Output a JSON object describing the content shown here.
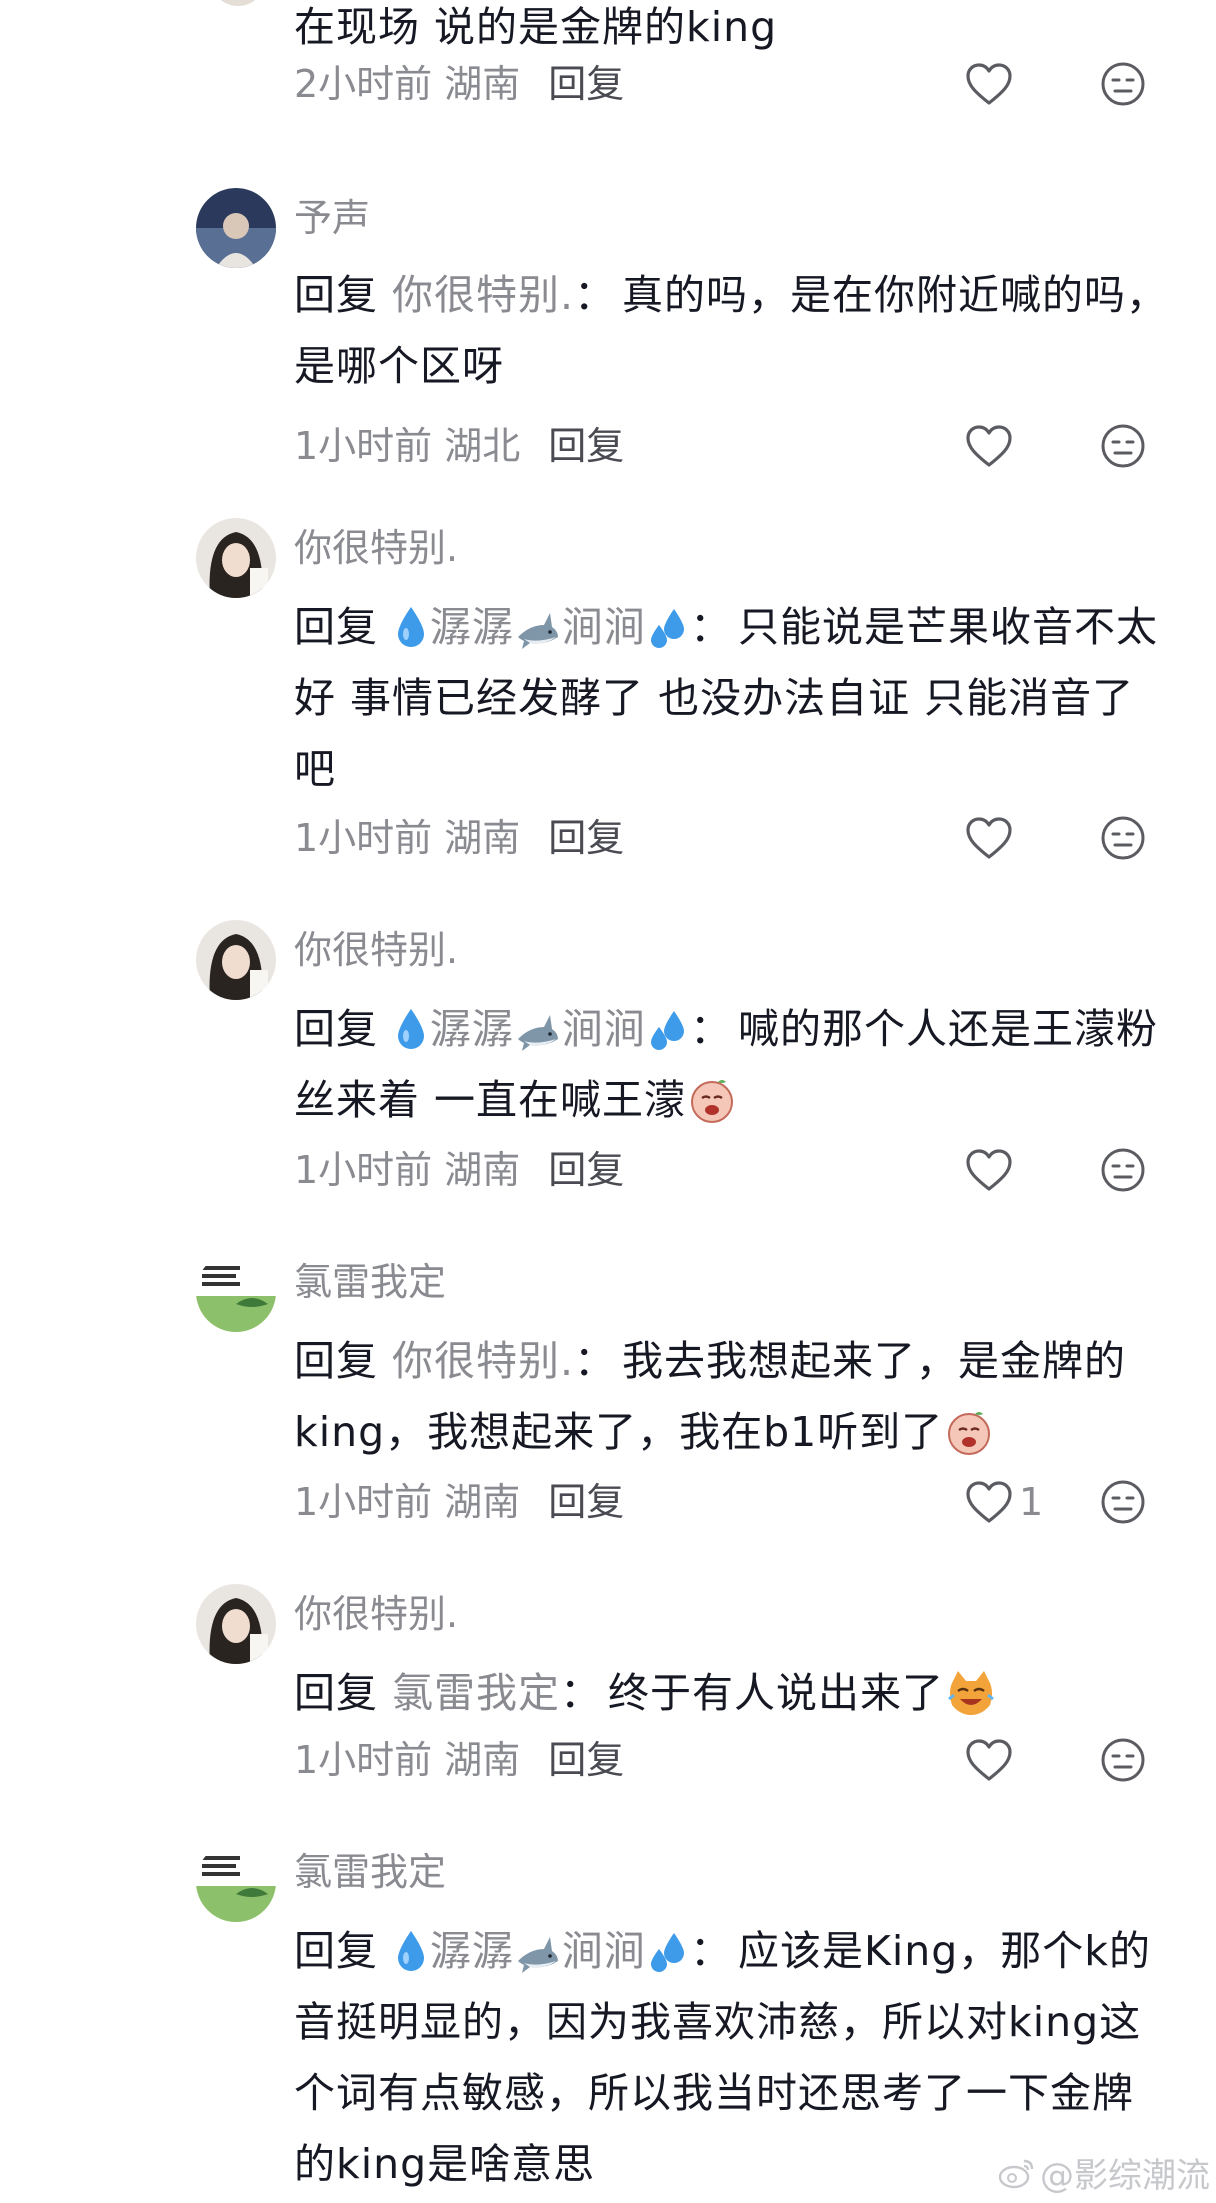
{
  "comments": [
    {
      "username": "",
      "reply_word": "",
      "reply_target": "",
      "text": "在现场 说的是金牌的king",
      "time": "2小时前",
      "region": "湖南",
      "reply_label": "回复",
      "likes": ""
    },
    {
      "username": "予声",
      "reply_word": "回复",
      "reply_target": "你很特别.",
      "text": "真的吗，是在你附近喊的吗，是哪个区呀",
      "time": "1小时前",
      "region": "湖北",
      "reply_label": "回复",
      "likes": ""
    },
    {
      "username": "你很特别.",
      "reply_word": "回复",
      "reply_target_pre": "",
      "reply_target_a": "潺潺",
      "reply_target_b": "涧涧",
      "text": "只能说是芒果收音不太好 事情已经发酵了 也没办法自证 只能消音了吧",
      "time": "1小时前",
      "region": "湖南",
      "reply_label": "回复",
      "likes": ""
    },
    {
      "username": "你很特别.",
      "reply_word": "回复",
      "reply_target_a": "潺潺",
      "reply_target_b": "涧涧",
      "text": "喊的那个人还是王濛粉丝来着 一直在喊王濛",
      "time": "1小时前",
      "region": "湖南",
      "reply_label": "回复",
      "likes": ""
    },
    {
      "username": "氯雷我定",
      "reply_word": "回复",
      "reply_target": "你很特别.",
      "text": "我去我想起来了，是金牌的king，我想起来了，我在b1听到了",
      "time": "1小时前",
      "region": "湖南",
      "reply_label": "回复",
      "likes": "1"
    },
    {
      "username": "你很特别.",
      "reply_word": "回复",
      "reply_target": "氯雷我定",
      "text": "终于有人说出来了",
      "time": "1小时前",
      "region": "湖南",
      "reply_label": "回复",
      "likes": ""
    },
    {
      "username": "氯雷我定",
      "reply_word": "回复",
      "reply_target_a": "潺潺",
      "reply_target_b": "涧涧",
      "text": "应该是King，那个k的音挺明显的，因为我喜欢沛慈，所以对king这个词有点敏感，所以我当时还思考了一下金牌的king是啥意思",
      "time": "",
      "region": "",
      "reply_label": "",
      "likes": ""
    }
  ],
  "colon": "：",
  "watermark": "@影综潮流",
  "icons": {
    "like": "heart-outline-icon",
    "dislike": "meh-face-icon",
    "water_drop": "water-drop-emoji",
    "shark": "shark-emoji",
    "sweat": "sweat-droplets-emoji",
    "crying": "crying-face-sticker",
    "cat": "laughing-cat-sticker",
    "weibo": "weibo-logo-icon"
  },
  "colors": {
    "text": "#161823",
    "secondary": "#8a8b91",
    "background": "#ffffff"
  }
}
